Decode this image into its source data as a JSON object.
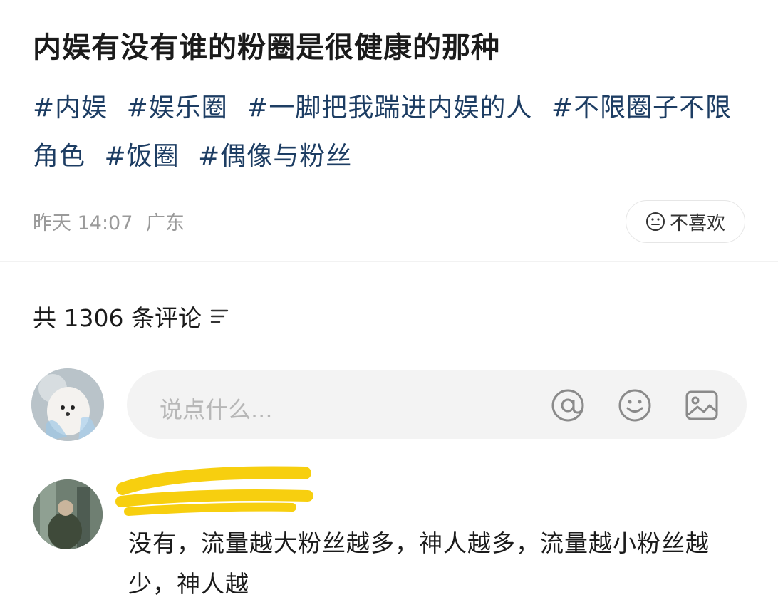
{
  "post": {
    "title": "内娱有没有谁的粉圈是很健康的那种",
    "tags": [
      "#内娱",
      "#娱乐圈",
      "#一脚把我踹进内娱的人",
      "#不限圈子不限角色",
      "#饭圈",
      "#偶像与粉丝"
    ],
    "time": "昨天 14:07",
    "location": "广东",
    "dislike_label": "不喜欢"
  },
  "comments": {
    "count_label": "共 1306 条评论",
    "input_placeholder": "说点什么...",
    "first_comment_text": "没有，流量越大粉丝越多，神人越多，流量越小粉丝越少，神人越"
  },
  "icons": {
    "sort": "sort-lines-icon",
    "at": "at-icon",
    "emoji": "smile-icon",
    "image": "image-icon",
    "dislike": "neutral-face-icon"
  },
  "colors": {
    "tag": "#1d3d63",
    "meta": "#9a9a9a",
    "redaction": "#f7cf0f"
  }
}
